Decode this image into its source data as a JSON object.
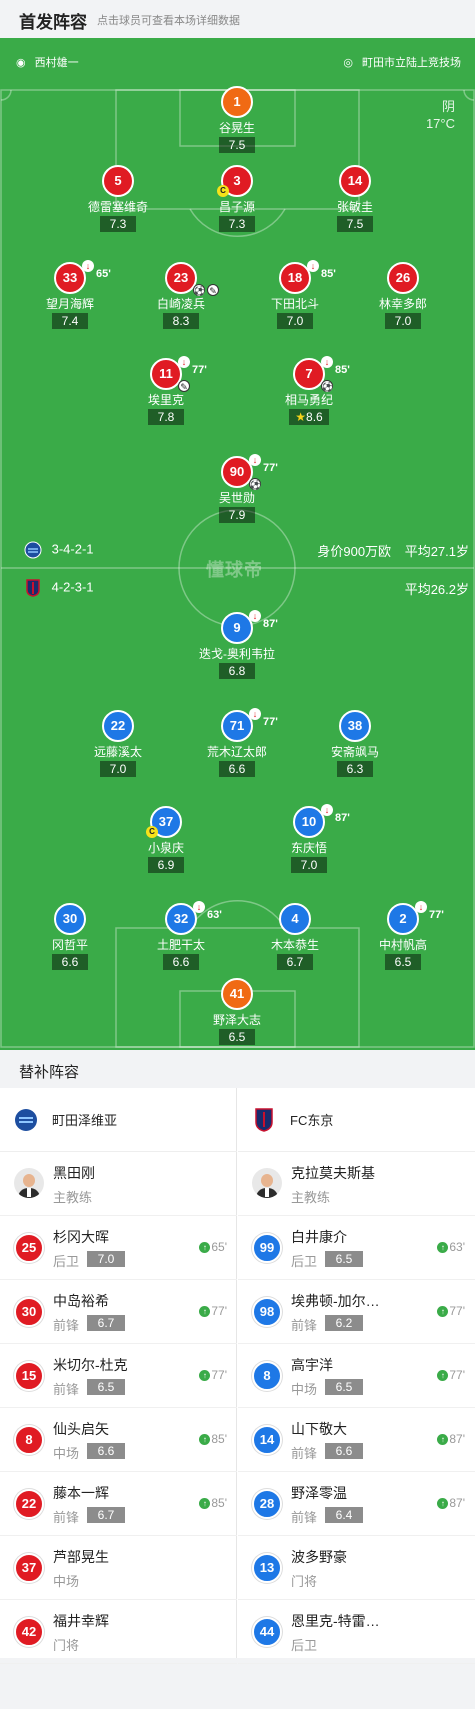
{
  "header": {
    "title": "首发阵容",
    "hint": "点击球员可查看本场详细数据"
  },
  "venue": {
    "referee": "西村雄一",
    "stadium": "町田市立陆上竞技场"
  },
  "weather": {
    "condition": "阴",
    "temp": "17°C"
  },
  "watermark": "懂球帝",
  "away_team": {
    "formation": "3-4-2-1",
    "value": "身价900万欧",
    "avg_age": "平均27.1岁",
    "players": [
      {
        "num": "1",
        "name": "谷晃生",
        "rating": "7.5"
      },
      {
        "num": "5",
        "name": "德雷塞维奇",
        "rating": "7.3"
      },
      {
        "num": "3",
        "name": "昌子源",
        "rating": "7.3",
        "captain": "C"
      },
      {
        "num": "14",
        "name": "张敏圭",
        "rating": "7.5"
      },
      {
        "num": "33",
        "name": "望月海辉",
        "rating": "7.4",
        "sub_min": "65'"
      },
      {
        "num": "23",
        "name": "白崎凌兵",
        "rating": "8.3"
      },
      {
        "num": "18",
        "name": "下田北斗",
        "rating": "7.0",
        "sub_min": "85'"
      },
      {
        "num": "26",
        "name": "林幸多郎",
        "rating": "7.0"
      },
      {
        "num": "11",
        "name": "埃里克",
        "rating": "7.8",
        "sub_min": "77'"
      },
      {
        "num": "7",
        "name": "相马勇纪",
        "rating": "8.6",
        "sub_min": "85'"
      },
      {
        "num": "90",
        "name": "吴世勋",
        "rating": "7.9",
        "sub_min": "77'"
      }
    ]
  },
  "home_team": {
    "formation": "4-2-3-1",
    "avg_age": "平均26.2岁",
    "players": [
      {
        "num": "9",
        "name": "迭戈-奥利韦拉",
        "rating": "6.8",
        "sub_min": "87'"
      },
      {
        "num": "22",
        "name": "远藤溪太",
        "rating": "7.0"
      },
      {
        "num": "71",
        "name": "荒木辽太郎",
        "rating": "6.6",
        "sub_min": "77'"
      },
      {
        "num": "38",
        "name": "安斋飒马",
        "rating": "6.3"
      },
      {
        "num": "37",
        "name": "小泉庆",
        "rating": "6.9",
        "captain": "C"
      },
      {
        "num": "10",
        "name": "东庆悟",
        "rating": "7.0",
        "sub_min": "87'"
      },
      {
        "num": "30",
        "name": "冈哲平",
        "rating": "6.6"
      },
      {
        "num": "32",
        "name": "土肥干太",
        "rating": "6.6",
        "sub_min": "63'"
      },
      {
        "num": "4",
        "name": "木本恭生",
        "rating": "6.7"
      },
      {
        "num": "2",
        "name": "中村帆高",
        "rating": "6.5",
        "sub_min": "77'"
      },
      {
        "num": "41",
        "name": "野泽大志",
        "rating": "6.5"
      }
    ]
  },
  "bench_title": "替补阵容",
  "bench": {
    "left": {
      "team": "町田泽维亚",
      "coach": {
        "name": "黑田刚",
        "role": "主教练"
      },
      "players": [
        {
          "num": "25",
          "name": "杉冈大晖",
          "pos": "后卫",
          "rating": "7.0",
          "min": "65'"
        },
        {
          "num": "30",
          "name": "中岛裕希",
          "pos": "前锋",
          "rating": "6.7",
          "min": "77'"
        },
        {
          "num": "15",
          "name": "米切尔-杜克",
          "pos": "前锋",
          "rating": "6.5",
          "min": "77'"
        },
        {
          "num": "8",
          "name": "仙头启矢",
          "pos": "中场",
          "rating": "6.6",
          "min": "85'"
        },
        {
          "num": "22",
          "name": "藤本一辉",
          "pos": "前锋",
          "rating": "6.7",
          "min": "85'"
        },
        {
          "num": "37",
          "name": "芦部晃生",
          "pos": "中场"
        },
        {
          "num": "42",
          "name": "福井幸辉",
          "pos": "门将"
        }
      ]
    },
    "right": {
      "team": "FC东京",
      "coach": {
        "name": "克拉莫夫斯基",
        "role": "主教练"
      },
      "players": [
        {
          "num": "99",
          "name": "白井康介",
          "pos": "后卫",
          "rating": "6.5",
          "min": "63'"
        },
        {
          "num": "98",
          "name": "埃弗顿-加尔…",
          "pos": "前锋",
          "rating": "6.2",
          "min": "77'"
        },
        {
          "num": "8",
          "name": "高宇洋",
          "pos": "中场",
          "rating": "6.5",
          "min": "77'"
        },
        {
          "num": "14",
          "name": "山下敬大",
          "pos": "前锋",
          "rating": "6.6",
          "min": "87'"
        },
        {
          "num": "28",
          "name": "野泽零温",
          "pos": "前锋",
          "rating": "6.4",
          "min": "87'"
        },
        {
          "num": "13",
          "name": "波多野豪",
          "pos": "门将"
        },
        {
          "num": "44",
          "name": "恩里克-特雷…",
          "pos": "后卫"
        }
      ]
    }
  }
}
